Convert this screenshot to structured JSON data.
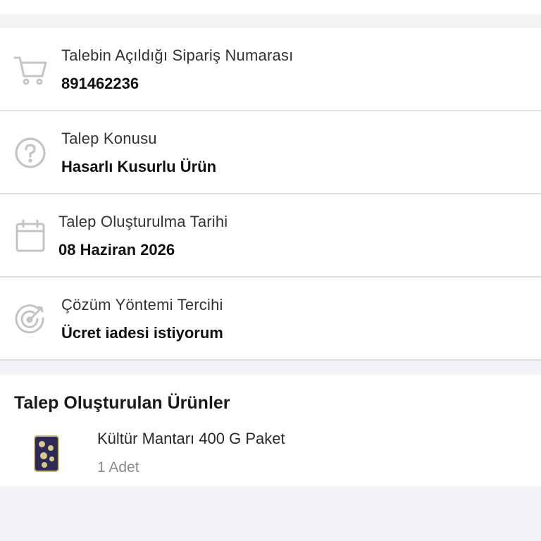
{
  "request_info": {
    "order_number": {
      "label": "Talebin Açıldığı Sipariş Numarası",
      "value": "891462236",
      "icon": "shopping-cart-icon"
    },
    "subject": {
      "label": "Talep Konusu",
      "value": "Hasarlı Kusurlu Ürün",
      "icon": "question-circle-icon"
    },
    "created_date": {
      "label": "Talep Oluşturulma Tarihi",
      "value": "08 Haziran 2026",
      "icon": "calendar-icon"
    },
    "resolution": {
      "label": "Çözüm Yöntemi Tercihi",
      "value": "Ücret iadesi istiyorum",
      "icon": "target-icon"
    }
  },
  "products": {
    "title": "Talep Oluşturulan Ürünler",
    "items": [
      {
        "name": "Kültür Mantarı 400 G Paket",
        "quantity": "1 Adet"
      }
    ]
  },
  "colors": {
    "icon_gray": "#c4c4c4",
    "divider": "#e0e0e0",
    "background": "#f3f3f5"
  }
}
